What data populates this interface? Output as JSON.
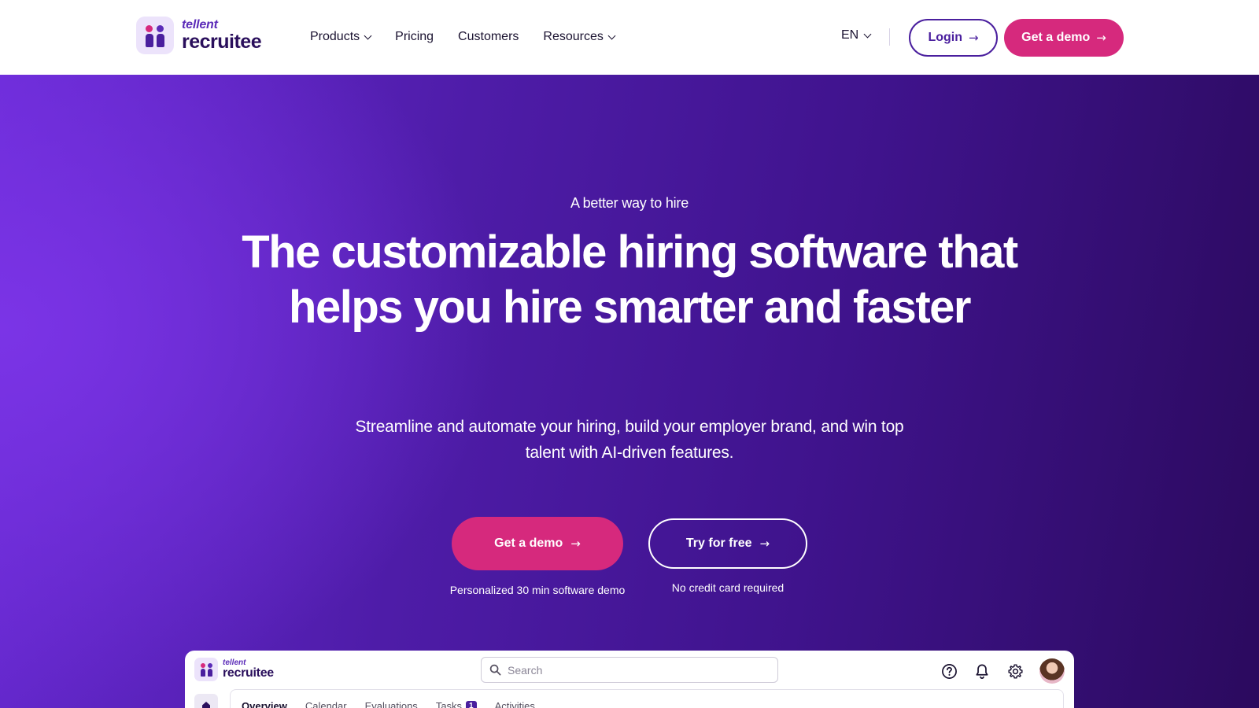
{
  "header": {
    "logo_brand": "tellent",
    "logo_product": "recruitee",
    "nav": [
      {
        "label": "Products",
        "has_dropdown": true
      },
      {
        "label": "Pricing",
        "has_dropdown": false
      },
      {
        "label": "Customers",
        "has_dropdown": false
      },
      {
        "label": "Resources",
        "has_dropdown": true
      }
    ],
    "language": "EN",
    "login_label": "Login",
    "demo_label": "Get a demo"
  },
  "hero": {
    "eyebrow": "A better way to hire",
    "headline": "The customizable hiring software that helps you hire smarter and faster",
    "subtitle": "Streamline and automate your hiring, build your employer brand, and win top talent with AI-driven features.",
    "cta_demo_label": "Get a demo",
    "cta_demo_note": "Personalized 30 min software demo",
    "cta_free_label": "Try for free",
    "cta_free_note": "No credit card required"
  },
  "preview": {
    "logo_brand": "tellent",
    "logo_product": "recruitee",
    "search_placeholder": "Search",
    "icons": [
      "help-icon",
      "bell-icon",
      "gear-icon",
      "avatar"
    ],
    "tabs": [
      {
        "label": "Overview",
        "active": true
      },
      {
        "label": "Calendar",
        "active": false
      },
      {
        "label": "Evaluations",
        "active": false
      },
      {
        "label": "Tasks",
        "active": false,
        "badge": "1"
      },
      {
        "label": "Activities",
        "active": false
      }
    ]
  },
  "colors": {
    "brand_purple": "#4a1f9e",
    "brand_pink": "#d6297d",
    "hero_gradient_start": "#7b34e6",
    "hero_gradient_end": "#2b0a5e"
  }
}
